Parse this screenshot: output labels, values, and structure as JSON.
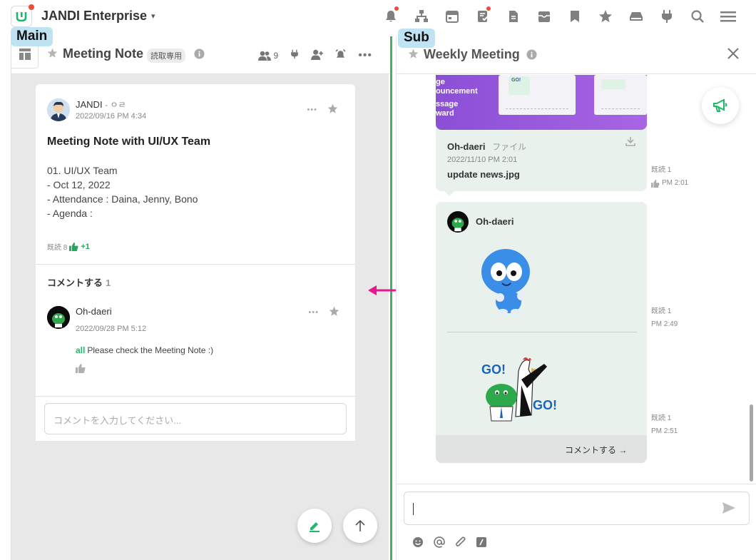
{
  "topbar": {
    "team_name": "JANDI Enterprise",
    "icons": [
      "bell-icon",
      "org-chart-icon",
      "calendar-icon",
      "todo-icon",
      "file-icon",
      "archive-icon",
      "bookmark-icon",
      "star-icon",
      "drive-icon",
      "plug-icon",
      "search-icon",
      "menu-icon"
    ]
  },
  "labels": {
    "main": "Main",
    "sub": "Sub"
  },
  "left": {
    "title": "Meeting Note",
    "read_only": "読取専用",
    "member_count": "9",
    "post": {
      "author": "JANDI",
      "author_suffix": "- ㅇㄹ",
      "date": "2022/09/16 PM 4:34",
      "title": "Meeting Note with UI/UX Team",
      "body": [
        "01. UI/UX Team",
        "- Oct 12, 2022",
        "- Attendance : Daina, Jenny, Bono",
        "- Agenda :"
      ],
      "read_label": "既読 8",
      "like_plus": "+1"
    },
    "comments": {
      "header": "コメントする",
      "count": "1",
      "author": "Oh-daeri",
      "date": "2022/09/28 PM 5:12",
      "mention": "all",
      "text": "Please check the Meeting Note :)",
      "input_placeholder": "コメントを入力してください..."
    }
  },
  "right": {
    "title": "Weekly Meeting",
    "preview_text": [
      "ge",
      "ouncement",
      "ssage",
      "ward"
    ],
    "sticker_go_text": "GO!",
    "file": {
      "author": "Oh-daeri",
      "type": "ファイル",
      "date": "2022/11/10 PM 2:01",
      "name": "update news.jpg",
      "read": "既読 1",
      "time": "PM 2:01"
    },
    "sticker_msg": {
      "author": "Oh-daeri",
      "read1": "既読 1",
      "time1": "PM 2:49",
      "read2": "既読 1",
      "time2": "PM 2:51",
      "go_text": "GO!",
      "comment_link": "コメントする →"
    }
  },
  "colors": {
    "accent": "#1eb86b",
    "divider": "#3fb55f",
    "arrow": "#e5188e",
    "label_bg": "#bfe3f2"
  }
}
